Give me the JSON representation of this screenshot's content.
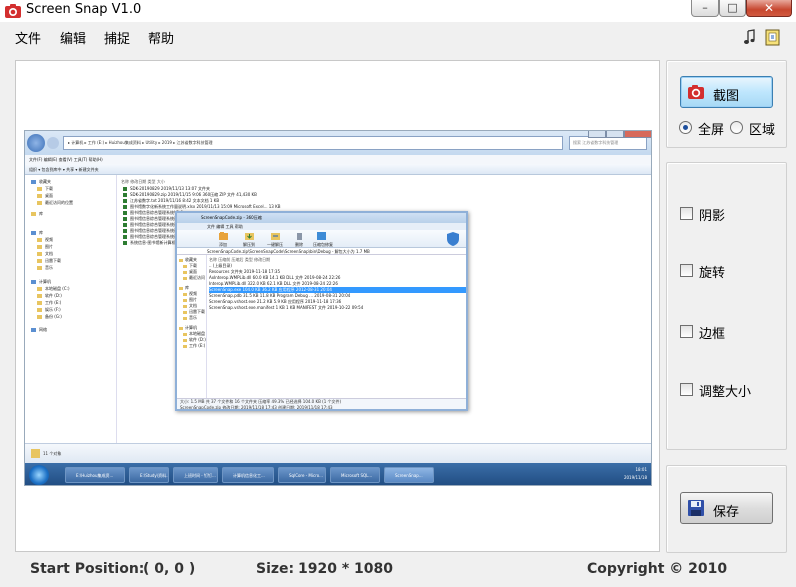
{
  "window": {
    "title": "Screen Snap V1.0"
  },
  "menu": {
    "file": "文件",
    "edit": "编辑",
    "capture": "捕捉",
    "help": "帮助"
  },
  "capture_button": {
    "label": "截图"
  },
  "mode": {
    "fullscreen_label": "全屏",
    "region_label": "区域",
    "selected": "fullscreen"
  },
  "effects": [
    {
      "label": "阴影",
      "checked": false
    },
    {
      "label": "旋转",
      "checked": false
    },
    {
      "label": "边框",
      "checked": false
    },
    {
      "label": "调整大小",
      "checked": false
    }
  ],
  "save_button": {
    "label": "保存"
  },
  "status": {
    "start_label": "Start Position:",
    "start_value": "( 0, 0 )",
    "size_label": "Size:",
    "size_value": "1920 * 1080",
    "copyright": "Copyright ©  2010"
  },
  "colors": {
    "accent": "#3c7fb1",
    "capture_icon": "#d32f2f",
    "save_icon": "#2f4fa8"
  },
  "preview": {
    "explorer": {
      "address": "▸ 计算机 ▸ 工作 (E:) ▸ Huizhou集成资料 ▸ Utility ▸ 2019 ▸ 江苏省数字科技管理",
      "search": "搜索 江苏省数字科技管理",
      "menu": "文件(F)   编辑(E)   查看(V)   工具(T)   帮助(H)",
      "toolbar": "组织 ▾    包含到库中 ▾    共享 ▾    新建文件夹",
      "nav": [
        "收藏夹",
        "下载",
        "桌面",
        "最近访问的位置",
        "库",
        "视频",
        "图片",
        "文档",
        "迅雷下载",
        "音乐",
        "计算机",
        "本地磁盘 (C:)",
        "软件 (D:)",
        "工作 (E:)",
        "娱乐 (F:)",
        "备份 (G:)",
        "网络"
      ],
      "columns": "名称                                              修改日期                  类型                大小",
      "files": [
        "SDK-20190829                                     2019/11/13 13:07     文件夹",
        "SDK-20190829.zip                                 2019/11/15 9:06      360压缩 ZIP 文件    41,430 KB",
        "江苏省数字.txt                                   2019/11/16 8:42      文本文档             1 KB",
        "图书馆数字化新系统工作量说明.xlsx               2019/11/13 15:09     Microsoft Excel...   13 KB",
        "图书馆信息综合管理系统V1.0",
        "图书馆信息综合管理系统说明",
        "图书馆信息综合管理系统说明",
        "图书馆信息综合管理系统说明",
        "图书馆信息综合管理系统说明",
        "系统信息-图书馆新计算机系统"
      ],
      "status": "11 个对象"
    },
    "zipwin": {
      "title": "ScreenSnapCode.zip - 360压缩",
      "tabs": "文件    编辑    工具    帮助",
      "ribbon": [
        "添加",
        "解压到",
        "一键解压",
        "删除",
        "压缩包修复"
      ],
      "path": "ScreenSnapCode.zip\\ScreenSnapCode\\ScreenSnap\\bin\\Debug - 解包大小为 1.7 MB",
      "nav": [
        "收藏夹",
        "下载",
        "桌面",
        "最近访问",
        "库",
        "视频",
        "图片",
        "文档",
        "迅雷下载",
        "音乐",
        "计算机",
        "本地磁盘",
        "软件 (D:)",
        "工作 (E:)"
      ],
      "columns": "名称                                      压缩前       压缩后      类型               修改日期",
      "rows": [
        "..  (上级目录)",
        "Resources                                                       文件夹              2019-11-18 17:35",
        "AxInterop.WMPLib.dll                  60.0 KB     14.1 KB    DLL 文件            2019-08-24 22:26",
        "Interop.WMPLib.dll                    322.0 KB    62.1 KB    DLL 文件            2019-08-24 22:26",
        "ScreenSnap.exe                        104.0 KB    36.2 KB    应用程序            2012-08-31 20:04",
        "ScreenSnap.pdb                        31.5 KB     11.8 KB    Program Debug ...   2019-08-31 20:04",
        "ScreenSnap.vshost.exe                 21.2 KB     5.9 KB     应用程序            2019-11-18 17:36",
        "ScreenSnap.vshost.exe.manifest        1 KB        1 KB       MANIFEST 文件       2019-10-22 09:54"
      ],
      "status1": "大小: 1.5 MB 共 37 个文件和 16 个文件夹  压缩率 49.3%  已经选择 104.0 KB (1 个文件)",
      "status2": "ScreenSnapCode.zip   修改日期: 2019/11/18 17:43    创建日期: 2019/11/18 17:43",
      "status3": "360压缩 ZIP 文件      大小: 1.87 MB"
    },
    "taskbar": {
      "items": [
        "E:\\Huizhou集成资...",
        "E:\\Study\\资料...",
        "上班时间 - 钉钉...",
        "计算机信息化工...",
        "SqlCore - Micro...",
        "Microsoft SQL...",
        "ScreenSnap..."
      ],
      "clock": "18:01\n2019/11/18"
    }
  }
}
